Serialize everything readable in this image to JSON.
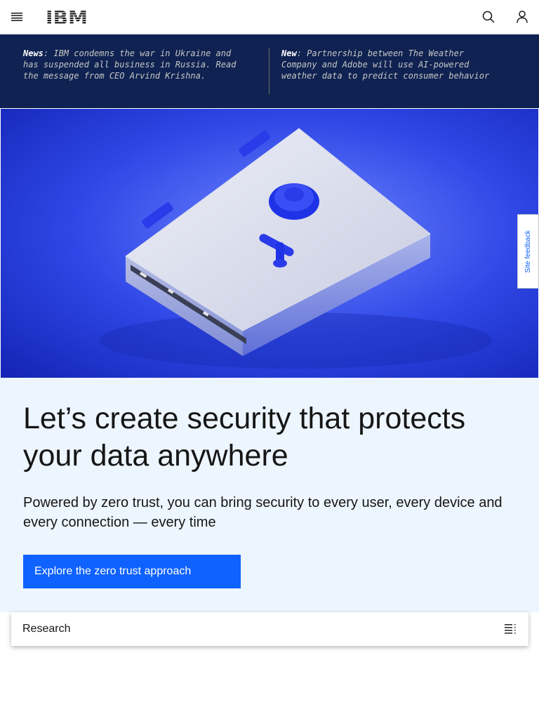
{
  "masthead": {
    "logo_text": "IBM",
    "menu_icon": "hamburger-menu-icon",
    "search_icon": "search-icon",
    "user_icon": "user-icon"
  },
  "news": {
    "items": [
      {
        "prefix": "News",
        "text": ": IBM condemns the war in Ukraine and has suspended all business in Russia. Read the message from CEO Arvind Krishna."
      },
      {
        "prefix": "New",
        "text": ": Partnership between The Weather Company and Adobe will use AI-powered weather data to predict consumer behavior"
      }
    ]
  },
  "hero": {
    "image": "blue-safe-illustration"
  },
  "feedback": {
    "label": "Site feedback"
  },
  "lead": {
    "title": "Let’s create security that protects your data anywhere",
    "subtitle": "Powered by zero trust, you can bring security to every user, every device and every connection — every time",
    "cta_label": "Explore the zero trust approach"
  },
  "toc": {
    "label": "Research",
    "icon": "table-of-contents-icon"
  },
  "colors": {
    "brand_blue": "#0f62fe",
    "news_bg": "#0f2251",
    "lead_bg": "#edf5ff"
  }
}
